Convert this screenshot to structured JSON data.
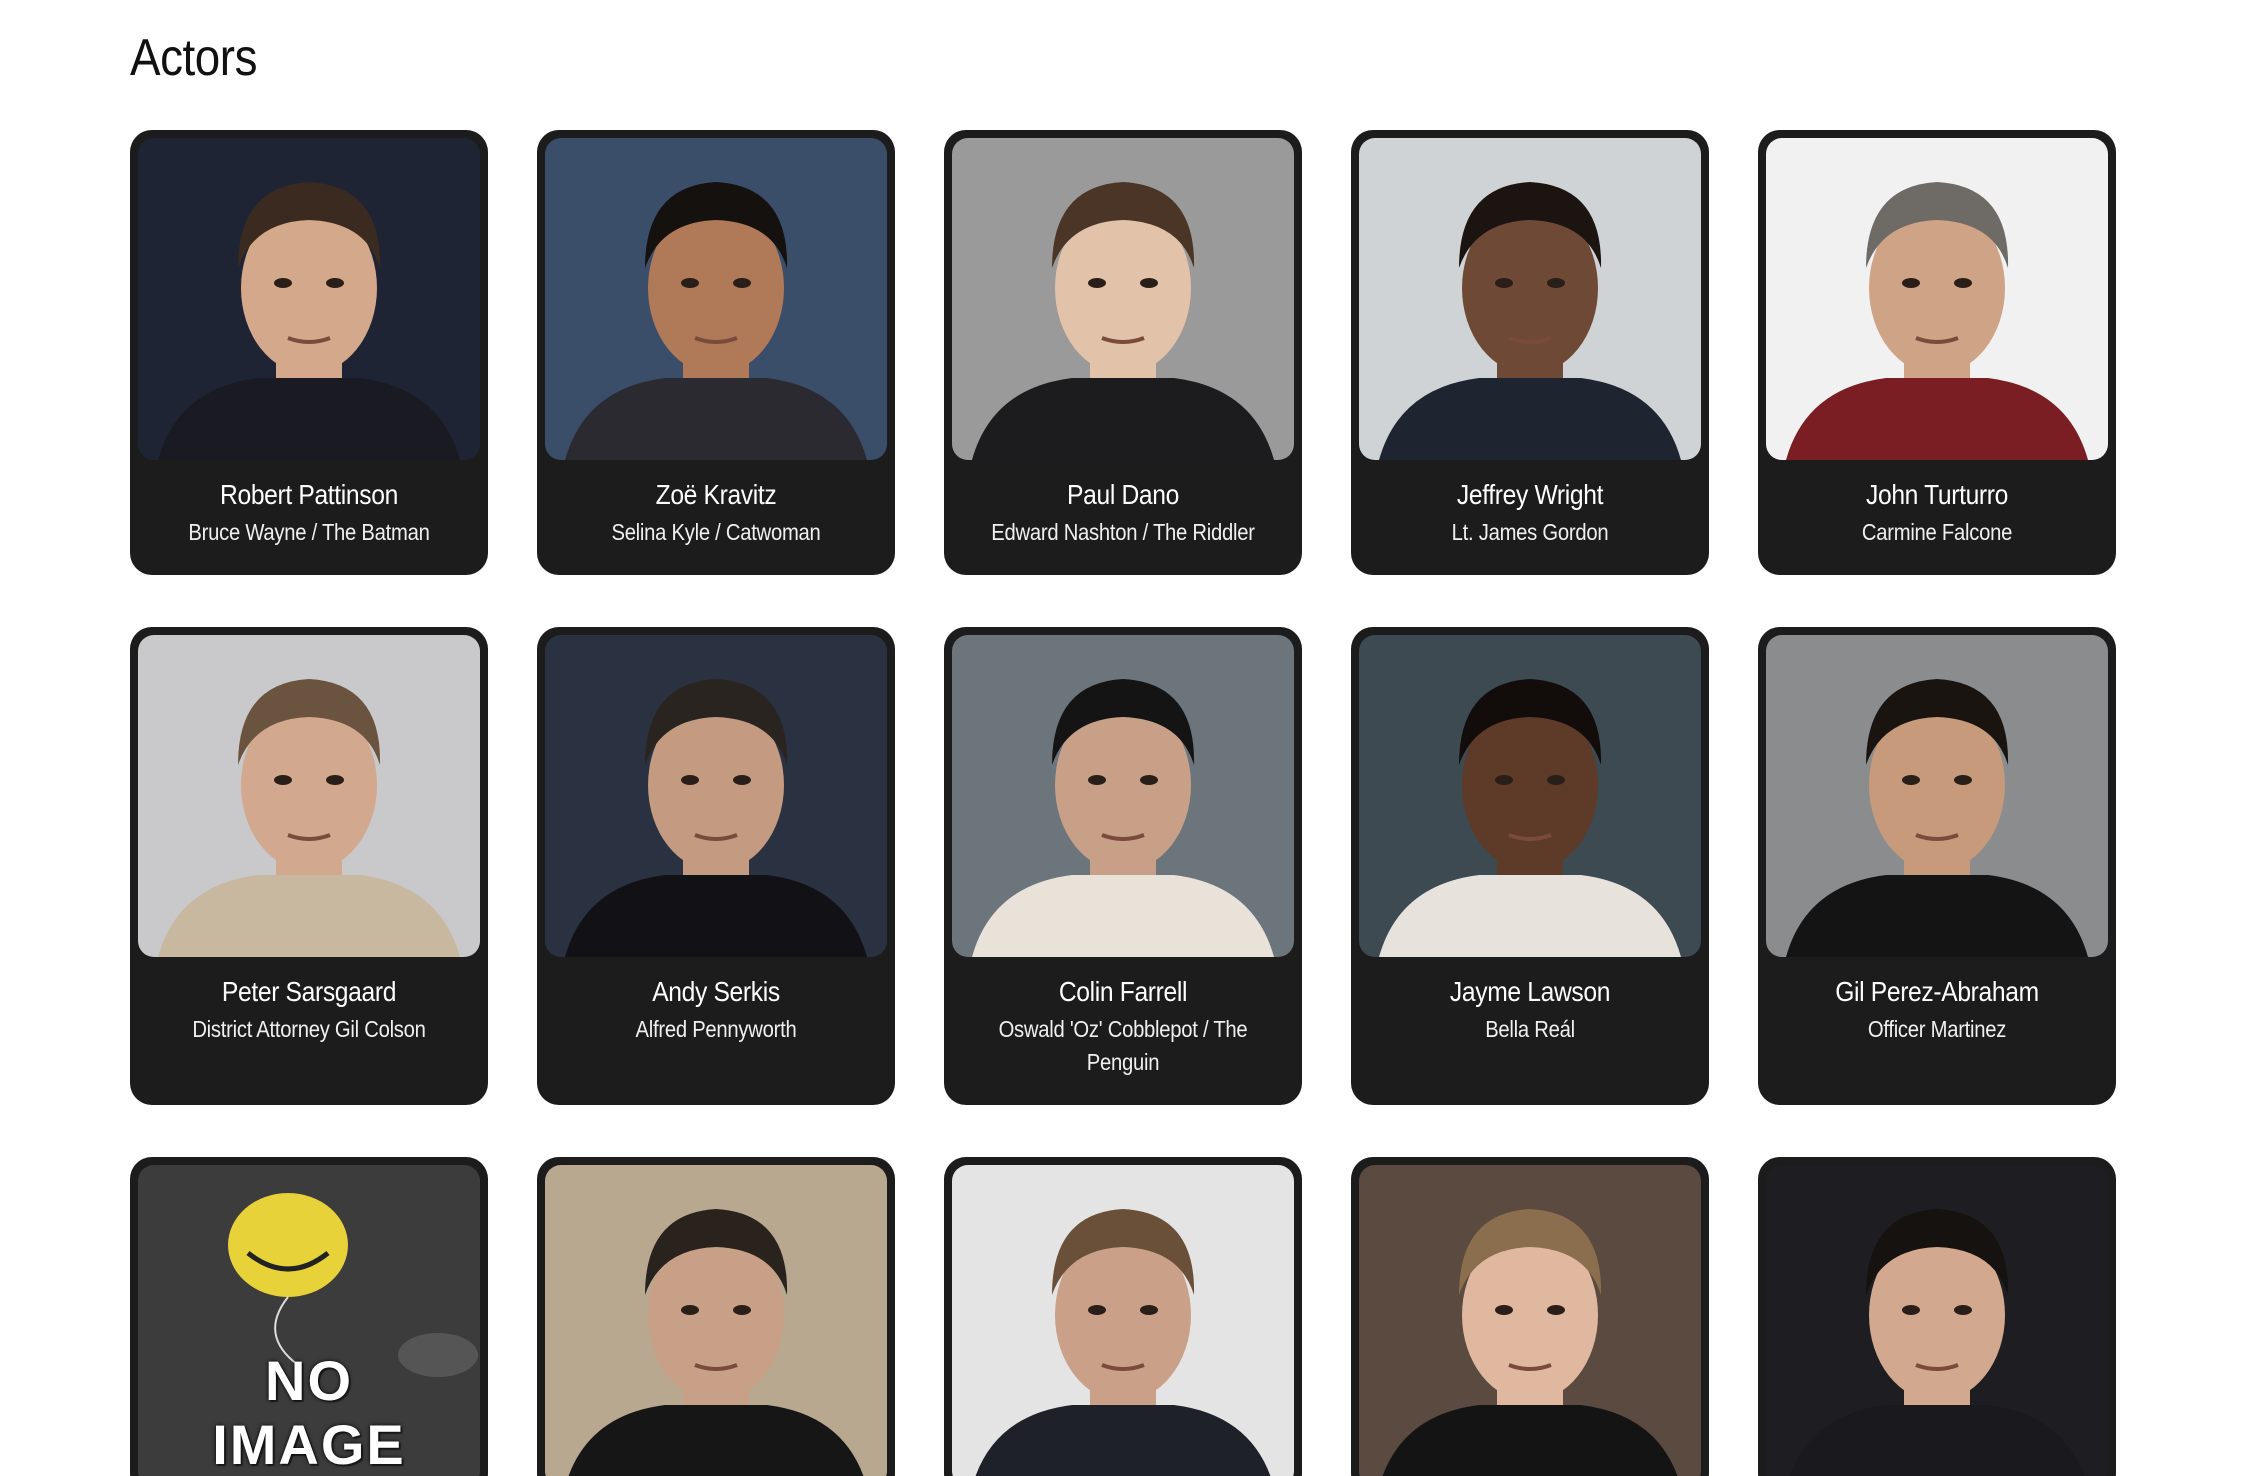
{
  "section": {
    "title": "Actors"
  },
  "actors": [
    {
      "name": "Robert Pattinson",
      "role": "Bruce Wayne / The Batman",
      "photo": "photo-portrait",
      "bg": "#1e2433",
      "skin": "#d4a88a",
      "hair": "#3a2a20",
      "shirt": "#1a1a22"
    },
    {
      "name": "Zoë Kravitz",
      "role": "Selina Kyle / Catwoman",
      "photo": "photo-portrait",
      "bg": "#3a4e6a",
      "skin": "#b07a58",
      "hair": "#15110f",
      "shirt": "#2a2a30"
    },
    {
      "name": "Paul Dano",
      "role": "Edward Nashton / The Riddler",
      "photo": "photo-portrait",
      "bg": "#9a9a9a",
      "skin": "#e2c2a8",
      "hair": "#4a3526",
      "shirt": "#1c1c1e"
    },
    {
      "name": "Jeffrey Wright",
      "role": "Lt. James Gordon",
      "photo": "photo-portrait",
      "bg": "#cfd3d6",
      "skin": "#6e4a36",
      "hair": "#1b1411",
      "shirt": "#1e2430"
    },
    {
      "name": "John Turturro",
      "role": "Carmine Falcone",
      "photo": "photo-portrait",
      "bg": "#f1f1f1",
      "skin": "#cfa385",
      "hair": "#6e6a66",
      "shirt": "#7a1e24"
    },
    {
      "name": "Peter Sarsgaard",
      "role": "District Attorney Gil Colson",
      "photo": "photo-portrait",
      "bg": "#c9c9cb",
      "skin": "#d2a98f",
      "hair": "#6a5440",
      "shirt": "#c8b8a0"
    },
    {
      "name": "Andy Serkis",
      "role": "Alfred Pennyworth",
      "photo": "photo-portrait",
      "bg": "#2a3140",
      "skin": "#c49a80",
      "hair": "#2a2420",
      "shirt": "#121216"
    },
    {
      "name": "Colin Farrell",
      "role": "Oswald 'Oz' Cobblepot / The Penguin",
      "photo": "photo-portrait",
      "bg": "#6c747c",
      "skin": "#c8a088",
      "hair": "#141414",
      "shirt": "#e8e2d8"
    },
    {
      "name": "Jayme Lawson",
      "role": "Bella Reál",
      "photo": "photo-portrait",
      "bg": "#3e4a52",
      "skin": "#5e3a28",
      "hair": "#120d0b",
      "shirt": "#e8e2dc"
    },
    {
      "name": "Gil Perez-Abraham",
      "role": "Officer Martinez",
      "photo": "photo-portrait",
      "bg": "#8a8c8e",
      "skin": "#c69a7a",
      "hair": "#1a1410",
      "shirt": "#141414"
    },
    {
      "name": "",
      "role": "",
      "photo": "no-image",
      "noimage_text": "NO IMAGE",
      "bg": "#3c3c3c",
      "skin": "#e8d23a",
      "hair": "#222",
      "shirt": "#444"
    },
    {
      "name": "",
      "role": "",
      "photo": "photo-portrait",
      "bg": "#b8a890",
      "skin": "#c8a088",
      "hair": "#2a221c",
      "shirt": "#161616"
    },
    {
      "name": "",
      "role": "",
      "photo": "photo-portrait",
      "bg": "#e4e4e4",
      "skin": "#caa088",
      "hair": "#6a5038",
      "shirt": "#1e2228"
    },
    {
      "name": "",
      "role": "",
      "photo": "photo-portrait",
      "bg": "#5a4a40",
      "skin": "#e0b8a0",
      "hair": "#8a6e4e",
      "shirt": "#141414"
    },
    {
      "name": "",
      "role": "",
      "photo": "photo-portrait",
      "bg": "#1e1e22",
      "skin": "#d2a88e",
      "hair": "#16120f",
      "shirt": "#1a1a1e"
    }
  ]
}
